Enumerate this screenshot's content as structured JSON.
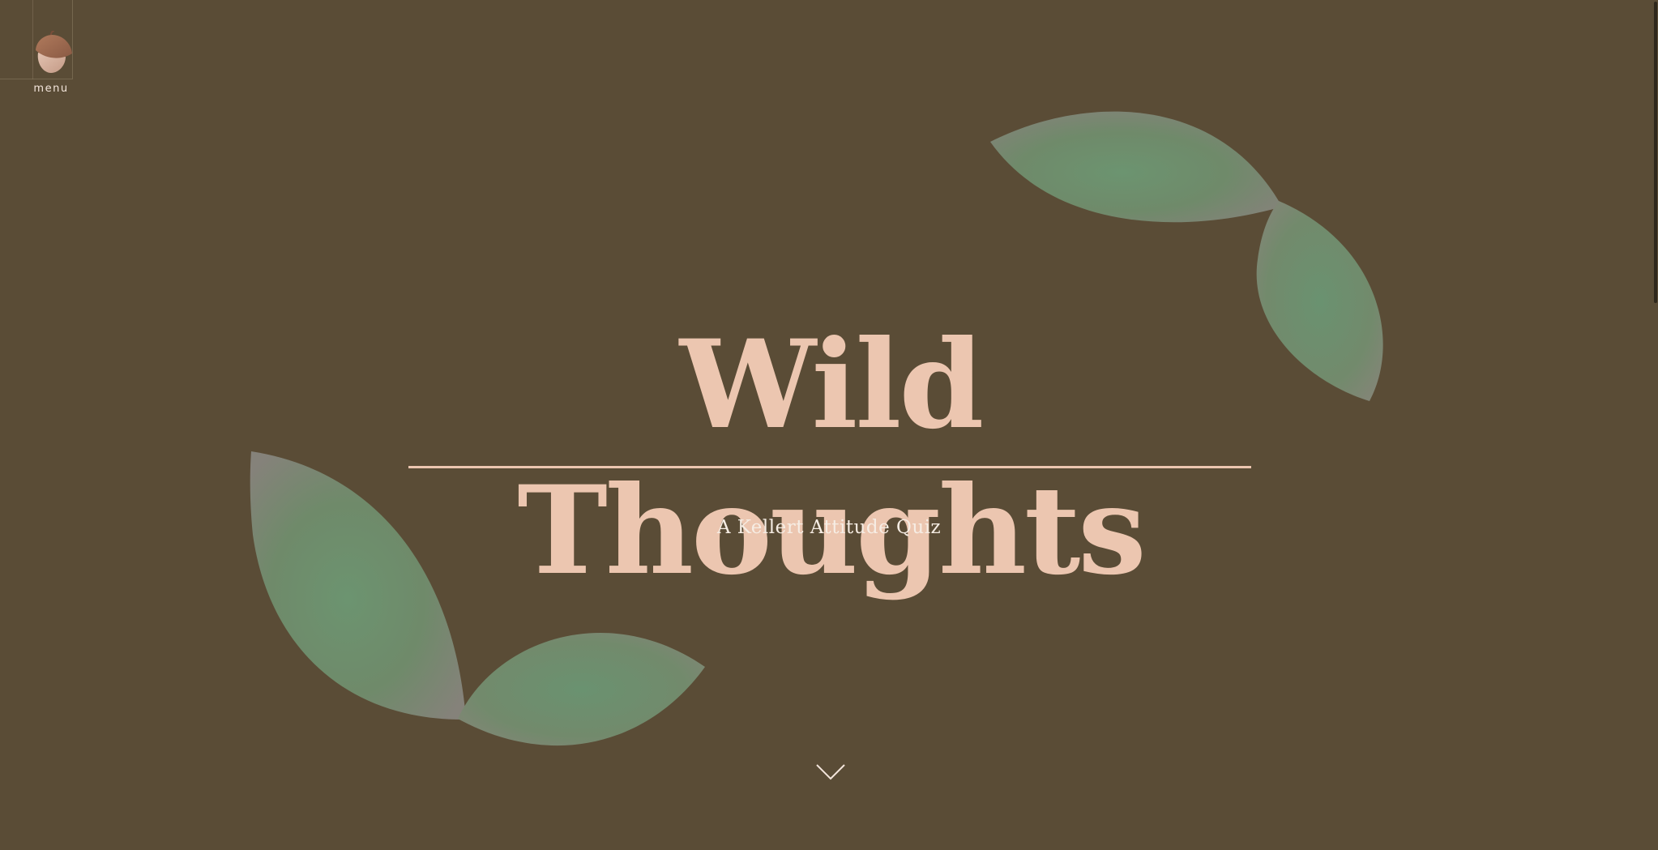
{
  "menu": {
    "label": "menu",
    "icon": "acorn-icon"
  },
  "hero": {
    "title": "Wild Thoughts",
    "subtitle": "A Kellert Attitude Quiz"
  },
  "scroll_down": {
    "icon": "chevron-down-icon"
  },
  "colors": {
    "background": "#5a4c36",
    "title": "#ecc6b0",
    "subtitle": "#f6ede4",
    "leaf": "#6a8f6e",
    "leaf_edge": "#87857a"
  }
}
